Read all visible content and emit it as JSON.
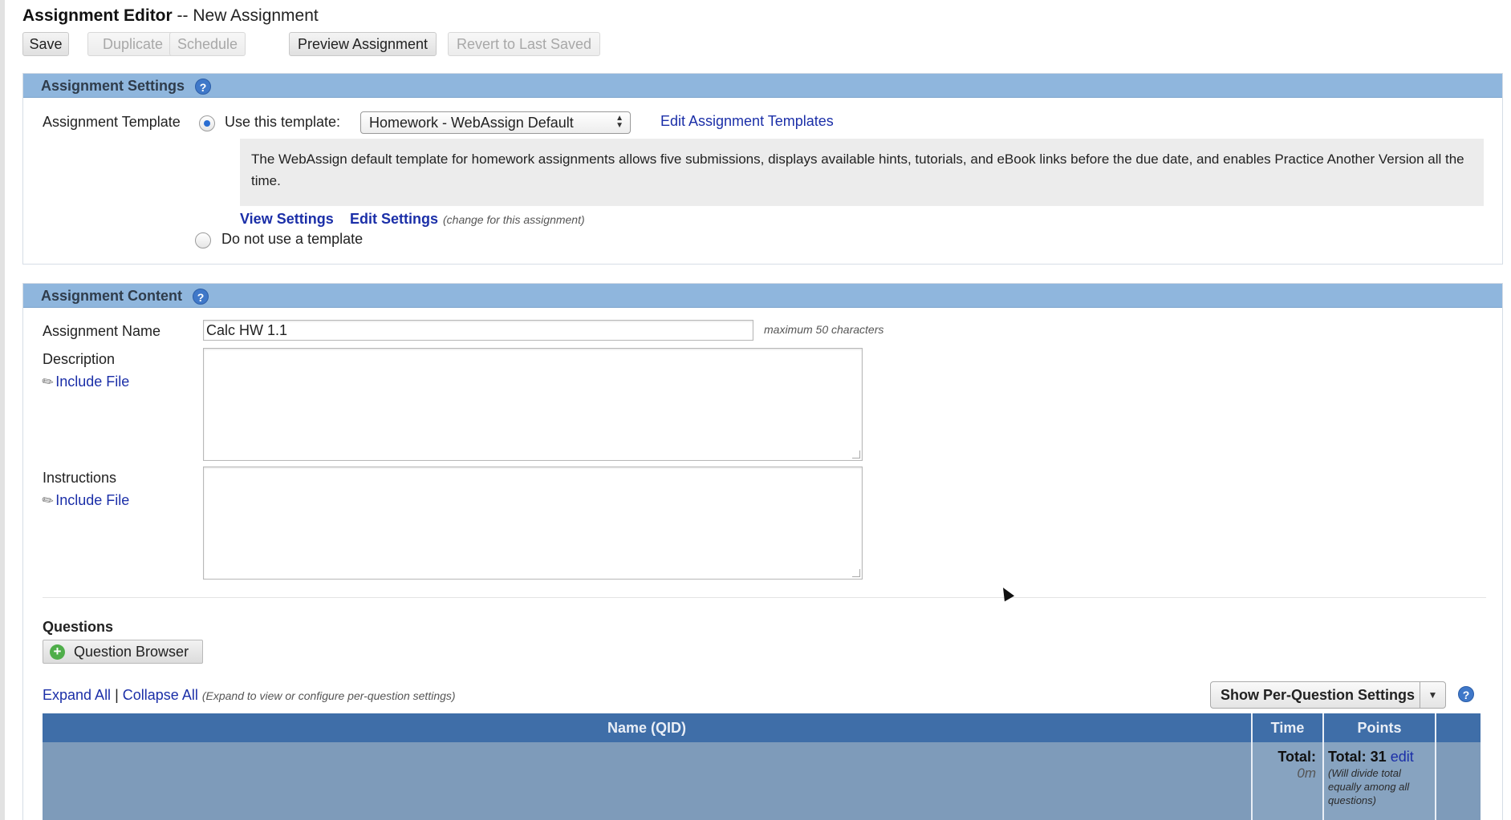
{
  "header": {
    "title_bold": "Assignment Editor",
    "title_rest": " -- New Assignment"
  },
  "toolbar": {
    "save": "Save",
    "duplicate": "Duplicate",
    "schedule": "Schedule",
    "preview": "Preview Assignment",
    "revert": "Revert to Last Saved"
  },
  "settings": {
    "heading": "Assignment Settings",
    "template_label": "Assignment Template",
    "use_template_label": "Use this template:",
    "template_value": "Homework - WebAssign Default",
    "edit_templates_link": "Edit Assignment Templates",
    "template_description": "The WebAssign default template for homework assignments allows five submissions, displays available hints, tutorials, and eBook links before the due date, and enables Practice Another Version all the time.",
    "view_settings": "View Settings",
    "edit_settings": "Edit Settings",
    "edit_settings_note": "(change for this assignment)",
    "no_template_label": "Do not use a template"
  },
  "content": {
    "heading": "Assignment Content",
    "name_label": "Assignment Name",
    "name_value": "Calc HW 1.1",
    "name_hint": "maximum 50 characters",
    "description_label": "Description",
    "instructions_label": "Instructions",
    "include_file": "Include File",
    "questions_label": "Questions",
    "question_browser": "Question Browser",
    "expand_all": "Expand All",
    "separator": "|",
    "collapse_all": "Collapse All",
    "expand_note": "(Expand to view or configure per-question settings)",
    "per_question_settings": "Show Per-Question Settings"
  },
  "grid": {
    "col_name": "Name (QID)",
    "col_time": "Time",
    "col_points": "Points",
    "time_total_label": "Total:",
    "time_total_value": "0m",
    "points_total_label": "Total: 31",
    "points_edit": "edit",
    "points_note": "(Will divide total equally among all questions)"
  },
  "icons": {
    "help": "question-mark-icon",
    "paperclip": "paperclip-icon",
    "add": "plus-icon",
    "dropdown": "chevron-down-icon",
    "select": "select-arrows-icon"
  },
  "colors": {
    "panel_header": "#8fb6dd",
    "grid_header": "#3f6ea8",
    "link": "#1b2fa8"
  }
}
